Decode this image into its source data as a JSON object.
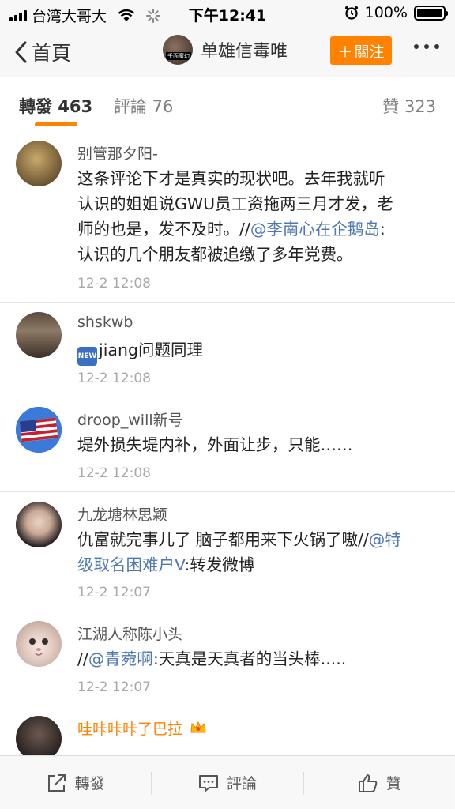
{
  "status_bar": {
    "carrier": "台湾大哥大",
    "time": "下午12:41",
    "battery": "100%"
  },
  "nav": {
    "back_label": "首頁",
    "title": "单雄信毒唯",
    "avatar_text": "千面魔幻",
    "follow_label": "關注"
  },
  "tabs": {
    "repost": "轉發 463",
    "comment": "評論 76",
    "like": "贊 323"
  },
  "items": [
    {
      "user": "别管那夕阳-",
      "line1": "这条评论下才是真实的现状吧。去年我就听",
      "line2": "认识的姐姐说GWU员工资拖两三月才发，老",
      "line3_pre": "师的也是，发不及时。//",
      "line3_mention": "@李南心在企鹅岛",
      "line3_post": ":",
      "line4": "认识的几个朋友都被追缴了多年党费。",
      "time": "12-2 12:08"
    },
    {
      "user": "shskwb",
      "badge": "NEW",
      "text": "jiang问题同理",
      "time": "12-2 12:08"
    },
    {
      "user": "droop_will新号",
      "text": "堤外损失堤内补，外面让步，只能……",
      "time": "12-2 12:08"
    },
    {
      "user": "九龙塘林思颖",
      "line1_pre": "仇富就完事儿了 脑子都用来下火锅了嗷//",
      "line1_mention": "@特",
      "line2_mention": "级取名困难户V",
      "line2_post": ":转发微博",
      "time": "12-2 12:07"
    },
    {
      "user": "江湖人称陈小头",
      "pre": "//",
      "mention": "@青菀啊",
      "post": ":天真是天真者的当头棒.....",
      "time": "12-2 12:07"
    },
    {
      "user": "哇咔咔咔了巴拉"
    }
  ],
  "bottom_bar": {
    "repost": "轉發",
    "comment": "評論",
    "like": "贊"
  },
  "colors": {
    "accent": "#ff8200",
    "mention": "#4e78b0"
  }
}
